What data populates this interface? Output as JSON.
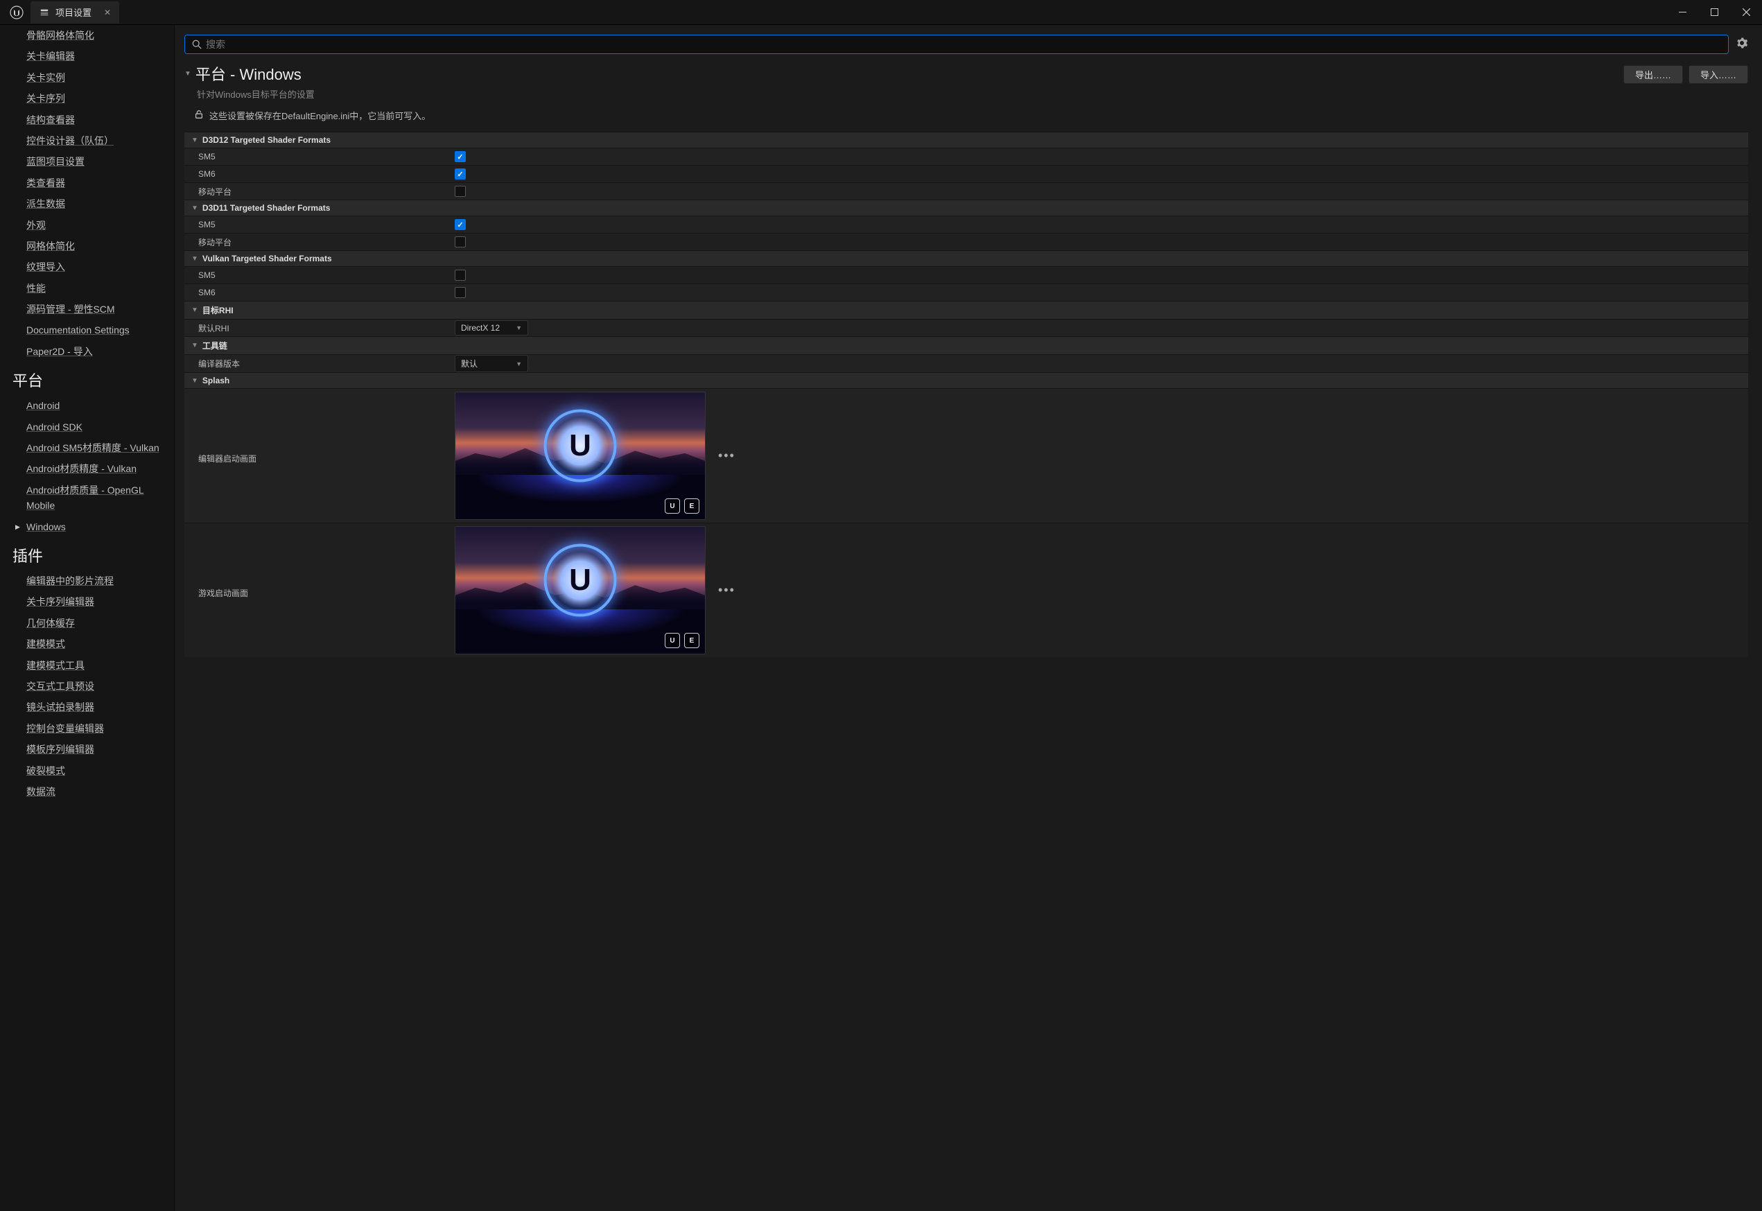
{
  "window": {
    "tab_title": "项目设置"
  },
  "search": {
    "placeholder": "搜索"
  },
  "sidebar": {
    "groups": [
      {
        "items": [
          "骨骼网格体简化",
          "关卡编辑器",
          "关卡实例",
          "关卡序列",
          "结构查看器",
          "控件设计器（队伍）",
          "蓝图项目设置",
          "类查看器",
          "派生数据",
          "外观",
          "网格体简化",
          "纹理导入",
          "性能",
          "源码管理 - 塑性SCM",
          "Documentation Settings",
          "Paper2D - 导入"
        ]
      },
      {
        "title": "平台",
        "items": [
          "Android",
          "Android SDK",
          "Android SM5材质精度 - Vulkan",
          "Android材质精度 - Vulkan",
          "Android材质质量 - OpenGL Mobile",
          "Windows"
        ],
        "selected_index": 5
      },
      {
        "title": "插件",
        "items": [
          "编辑器中的影片流程",
          "关卡序列编辑器",
          "几何体缓存",
          "建模模式",
          "建模模式工具",
          "交互式工具预设",
          "镜头试拍录制器",
          "控制台变量编辑器",
          "模板序列编辑器",
          "破裂模式",
          "数据流"
        ]
      }
    ]
  },
  "page": {
    "title": "平台 - Windows",
    "subtitle": "针对Windows目标平台的设置",
    "export_btn": "导出……",
    "import_btn": "导入……",
    "lock_text": "这些设置被保存在DefaultEngine.ini中，它当前可写入。"
  },
  "sections": [
    {
      "header": "D3D12 Targeted Shader Formats",
      "rows": [
        {
          "label": "SM5",
          "type": "check",
          "checked": true
        },
        {
          "label": "SM6",
          "type": "check",
          "checked": true
        },
        {
          "label": "移动平台",
          "type": "check",
          "checked": false
        }
      ]
    },
    {
      "header": "D3D11 Targeted Shader Formats",
      "rows": [
        {
          "label": "SM5",
          "type": "check",
          "checked": true
        },
        {
          "label": "移动平台",
          "type": "check",
          "checked": false
        }
      ]
    },
    {
      "header": "Vulkan Targeted Shader Formats",
      "rows": [
        {
          "label": "SM5",
          "type": "check",
          "checked": false
        },
        {
          "label": "SM6",
          "type": "check",
          "checked": false
        }
      ]
    },
    {
      "header": "目标RHI",
      "rows": [
        {
          "label": "默认RHI",
          "type": "dropdown",
          "value": "DirectX 12"
        }
      ]
    },
    {
      "header": "工具链",
      "rows": [
        {
          "label": "编译器版本",
          "type": "dropdown",
          "value": "默认"
        }
      ]
    },
    {
      "header": "Splash",
      "rows": [
        {
          "label": "编辑器启动画面",
          "type": "splash"
        },
        {
          "label": "游戏启动画面",
          "type": "splash"
        }
      ]
    }
  ]
}
